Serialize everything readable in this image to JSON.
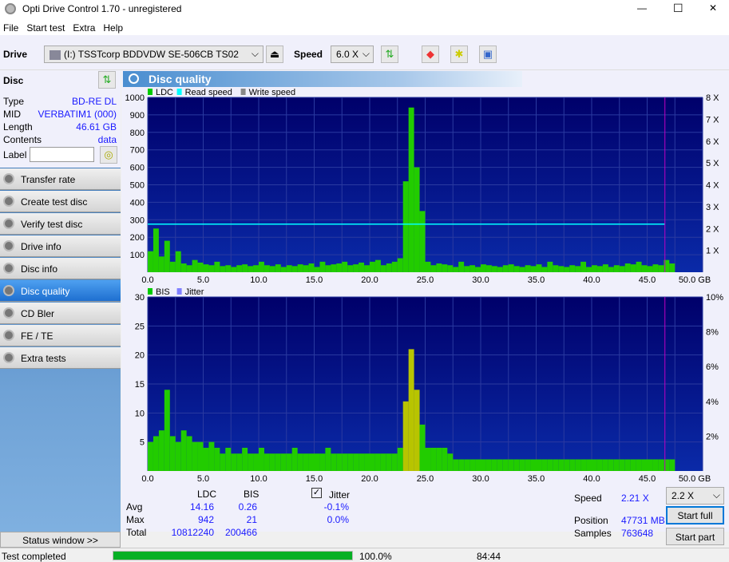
{
  "window": {
    "title": "Opti Drive Control 1.70 - unregistered",
    "minimize": "—",
    "maximize": "☐",
    "close": "✕"
  },
  "menu": [
    "File",
    "Start test",
    "Extra",
    "Help"
  ],
  "toolbar": {
    "drive_label": "Drive",
    "drive_value": "(I:)   TSSTcorp BDDVDW SE-506CB TS02",
    "speed_label": "Speed",
    "speed_value": "6.0 X"
  },
  "disc": {
    "header": "Disc",
    "type_label": "Type",
    "type": "BD-RE DL",
    "mid_label": "MID",
    "mid": "VERBATIM1 (000)",
    "length_label": "Length",
    "length": "46.61 GB",
    "contents_label": "Contents",
    "contents": "data",
    "label_label": "Label",
    "label_value": ""
  },
  "sidebar": [
    {
      "label": "Transfer rate"
    },
    {
      "label": "Create test disc"
    },
    {
      "label": "Verify test disc"
    },
    {
      "label": "Drive info"
    },
    {
      "label": "Disc info"
    },
    {
      "label": "Disc quality",
      "active": true
    },
    {
      "label": "CD Bler"
    },
    {
      "label": "FE / TE"
    },
    {
      "label": "Extra tests"
    }
  ],
  "status_window": "Status window >>",
  "panel_title": "Disc quality",
  "colors": {
    "ldc": "#00cc00",
    "read_speed": "#00ffff",
    "write_speed": "#888888",
    "bis": "#00cc00",
    "jitter": "#8080ff",
    "bg": "#00007a",
    "grid": "#2a3aa0",
    "end_marker": "#c000c0"
  },
  "chart_data": [
    {
      "type": "bar",
      "legend": [
        "LDC",
        "Read speed",
        "Write speed"
      ],
      "xlim": [
        0,
        50
      ],
      "ylim": [
        0,
        1000
      ],
      "y2lim": [
        0,
        8
      ],
      "xticks": [
        "0.0",
        "5.0",
        "10.0",
        "15.0",
        "20.0",
        "25.0",
        "30.0",
        "35.0",
        "40.0",
        "45.0",
        "50.0 GB"
      ],
      "yticks": [
        "100",
        "200",
        "300",
        "400",
        "500",
        "600",
        "700",
        "800",
        "900",
        "1000"
      ],
      "y2ticks": [
        "1 X",
        "2 X",
        "3 X",
        "4 X",
        "5 X",
        "6 X",
        "7 X",
        "8 X"
      ],
      "x_step": 0.5,
      "ldc": [
        120,
        250,
        90,
        180,
        60,
        120,
        50,
        40,
        70,
        55,
        45,
        40,
        60,
        35,
        40,
        30,
        40,
        45,
        35,
        40,
        60,
        40,
        35,
        45,
        30,
        40,
        35,
        45,
        40,
        50,
        30,
        60,
        40,
        45,
        50,
        60,
        40,
        45,
        55,
        40,
        60,
        70,
        40,
        50,
        60,
        80,
        520,
        942,
        600,
        350,
        60,
        40,
        50,
        45,
        40,
        30,
        60,
        35,
        40,
        30,
        45,
        40,
        35,
        30,
        40,
        45,
        35,
        30,
        40,
        35,
        45,
        30,
        60,
        40,
        35,
        30,
        40,
        35,
        60,
        30,
        40,
        35,
        45,
        30,
        40,
        35,
        50,
        45,
        60,
        40,
        35,
        45,
        40,
        70,
        50
      ],
      "read_speed": {
        "x": [
          0,
          46.6
        ],
        "y": [
          2.2,
          2.2
        ]
      },
      "end_gb": 46.6
    },
    {
      "type": "bar",
      "legend": [
        "BIS",
        "Jitter"
      ],
      "xlim": [
        0,
        50
      ],
      "ylim": [
        0,
        30
      ],
      "y2lim": [
        0,
        10
      ],
      "xticks": [
        "0.0",
        "5.0",
        "10.0",
        "15.0",
        "20.0",
        "25.0",
        "30.0",
        "35.0",
        "40.0",
        "45.0",
        "50.0 GB"
      ],
      "yticks": [
        "5",
        "10",
        "15",
        "20",
        "25",
        "30"
      ],
      "y2ticks": [
        "2%",
        "4%",
        "6%",
        "8%",
        "10%"
      ],
      "x_step": 0.5,
      "bis": [
        5,
        6,
        7,
        14,
        6,
        5,
        7,
        6,
        5,
        5,
        4,
        5,
        4,
        3,
        4,
        3,
        3,
        4,
        3,
        3,
        4,
        3,
        3,
        3,
        3,
        3,
        4,
        3,
        3,
        3,
        3,
        3,
        4,
        3,
        3,
        3,
        3,
        3,
        3,
        3,
        3,
        3,
        3,
        3,
        3,
        4,
        12,
        21,
        14,
        8,
        4,
        4,
        4,
        4,
        3,
        2,
        2,
        2,
        2,
        2,
        2,
        2,
        2,
        2,
        2,
        2,
        2,
        2,
        2,
        2,
        2,
        2,
        2,
        2,
        2,
        2,
        2,
        2,
        2,
        2,
        2,
        2,
        2,
        2,
        2,
        2,
        2,
        2,
        2,
        2,
        2,
        2,
        2,
        2,
        2
      ],
      "end_gb": 46.6
    }
  ],
  "stats": {
    "col_ldc": "LDC",
    "col_bis": "BIS",
    "jitter_label": "Jitter",
    "jitter_checked": true,
    "rows": [
      {
        "label": "Avg",
        "ldc": "14.16",
        "bis": "0.26",
        "jitter": "-0.1%"
      },
      {
        "label": "Max",
        "ldc": "942",
        "bis": "21",
        "jitter": "0.0%"
      },
      {
        "label": "Total",
        "ldc": "10812240",
        "bis": "200466",
        "jitter": ""
      }
    ],
    "speed_label": "Speed",
    "speed": "2.21 X",
    "position_label": "Position",
    "position": "47731 MB",
    "samples_label": "Samples",
    "samples": "763648",
    "speed_select": "2.2 X",
    "start_full": "Start full",
    "start_part": "Start part"
  },
  "status": {
    "text": "Test completed",
    "progress": 100,
    "progress_text": "100.0%",
    "time": "84:44"
  }
}
